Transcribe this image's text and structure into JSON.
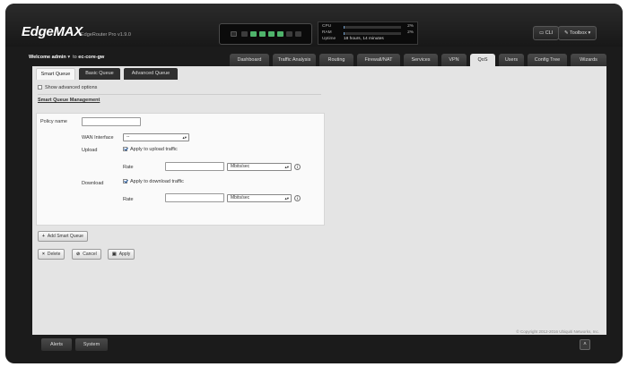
{
  "header": {
    "logo": "EdgeMAX",
    "model": "EdgeRouter Pro v1.9.0",
    "stats": {
      "cpu_label": "CPU",
      "cpu_value": "2%",
      "cpu_fraction": 0.02,
      "ram_label": "RAM",
      "ram_value": "2%",
      "ram_fraction": 0.02,
      "uptime_label": "Uptime",
      "uptime_value": "18 hours, 14 minutes"
    },
    "cli_label": "CLI",
    "toolbox_label": "Toolbox"
  },
  "nav": {
    "welcome_prefix": "Welcome",
    "user": "admin",
    "host_prefix": "to",
    "host": "ec-core-gw",
    "tabs": [
      "Dashboard",
      "Traffic Analysis",
      "Routing",
      "Firewall/NAT",
      "Services",
      "VPN",
      "QoS",
      "Users",
      "Config Tree",
      "Wizards"
    ],
    "active_tab": "QoS"
  },
  "subtabs": [
    "Smart Queue",
    "Basic Queue",
    "Advanced Queue"
  ],
  "show_advanced": "Show advanced options",
  "section_title": "Smart Queue Management",
  "form": {
    "policy_name_label": "Policy name",
    "policy_name_value": "",
    "wan_interface_label": "WAN Interface",
    "wan_interface_value": "--",
    "upload_label": "Upload",
    "apply_upload_label": "Apply to upload traffic",
    "download_label": "Download",
    "apply_download_label": "Apply to download traffic",
    "rate_label": "Rate",
    "upload_rate_value": "",
    "download_rate_value": "",
    "rate_unit": "Mbits/sec"
  },
  "buttons": {
    "add": "Add Smart Queue",
    "delete": "Delete",
    "cancel": "Cancel",
    "apply": "Apply"
  },
  "copyright": "© Copyright 2012-2016 Ubiquiti Networks, Inc.",
  "bottom": {
    "alerts": "Alerts",
    "system": "System"
  },
  "colors": {
    "header_bg": "#1b1b1b",
    "content_bg": "#e4e4e4",
    "port_active": "#4fb36b"
  }
}
